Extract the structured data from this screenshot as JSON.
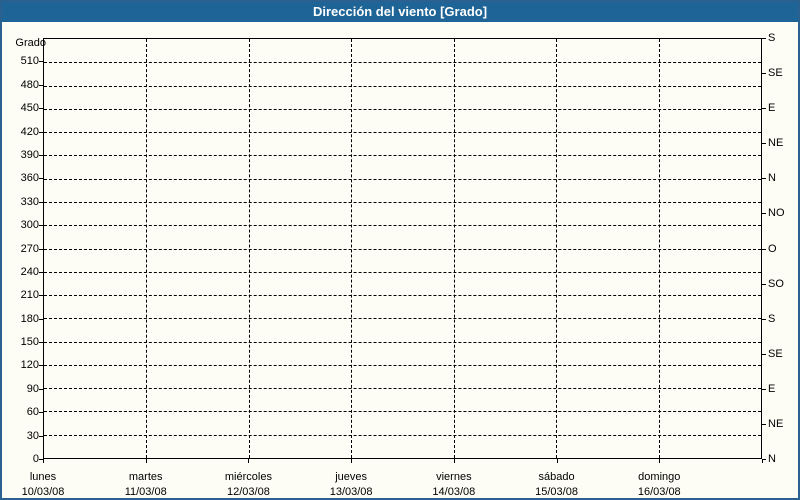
{
  "window": {
    "title": "Dirección del viento [Grado]"
  },
  "colors": {
    "titlebar_bg": "#1E6496",
    "frame_border": "#2B6191",
    "title_text": "#FFFFFF",
    "page_bg": "#FDFDF6",
    "axis_line": "#000000",
    "grid_line": "#000000",
    "label_text": "#000000"
  },
  "chart_data": {
    "type": "line",
    "title": "Dirección del viento [Grado]",
    "grid": {
      "style": "dashed",
      "horizontal_step": 30,
      "vertical": "day-boundaries"
    },
    "y_axis_left": {
      "unit_label": "Grado",
      "min": 0,
      "max": 540,
      "tick_step": 30,
      "tick_labels": [
        0,
        30,
        60,
        90,
        120,
        150,
        180,
        210,
        240,
        270,
        300,
        330,
        360,
        390,
        420,
        450,
        480,
        510
      ]
    },
    "y_axis_right": {
      "ticks": [
        {
          "value": 0,
          "label": "N"
        },
        {
          "value": 45,
          "label": "NE"
        },
        {
          "value": 90,
          "label": "E"
        },
        {
          "value": 135,
          "label": "SE"
        },
        {
          "value": 180,
          "label": "S"
        },
        {
          "value": 225,
          "label": "SO"
        },
        {
          "value": 270,
          "label": "O"
        },
        {
          "value": 315,
          "label": "NO"
        },
        {
          "value": 360,
          "label": "N"
        },
        {
          "value": 405,
          "label": "NE"
        },
        {
          "value": 450,
          "label": "E"
        },
        {
          "value": 495,
          "label": "SE"
        },
        {
          "value": 540,
          "label": "S"
        }
      ]
    },
    "x_axis": {
      "divisions": 7,
      "days": [
        {
          "name": "lunes",
          "date": "10/03/08"
        },
        {
          "name": "martes",
          "date": "11/03/08"
        },
        {
          "name": "miércoles",
          "date": "12/03/08"
        },
        {
          "name": "jueves",
          "date": "13/03/08"
        },
        {
          "name": "viernes",
          "date": "14/03/08"
        },
        {
          "name": "sábado",
          "date": "15/03/08"
        },
        {
          "name": "domingo",
          "date": "16/03/08"
        }
      ]
    },
    "series": []
  }
}
